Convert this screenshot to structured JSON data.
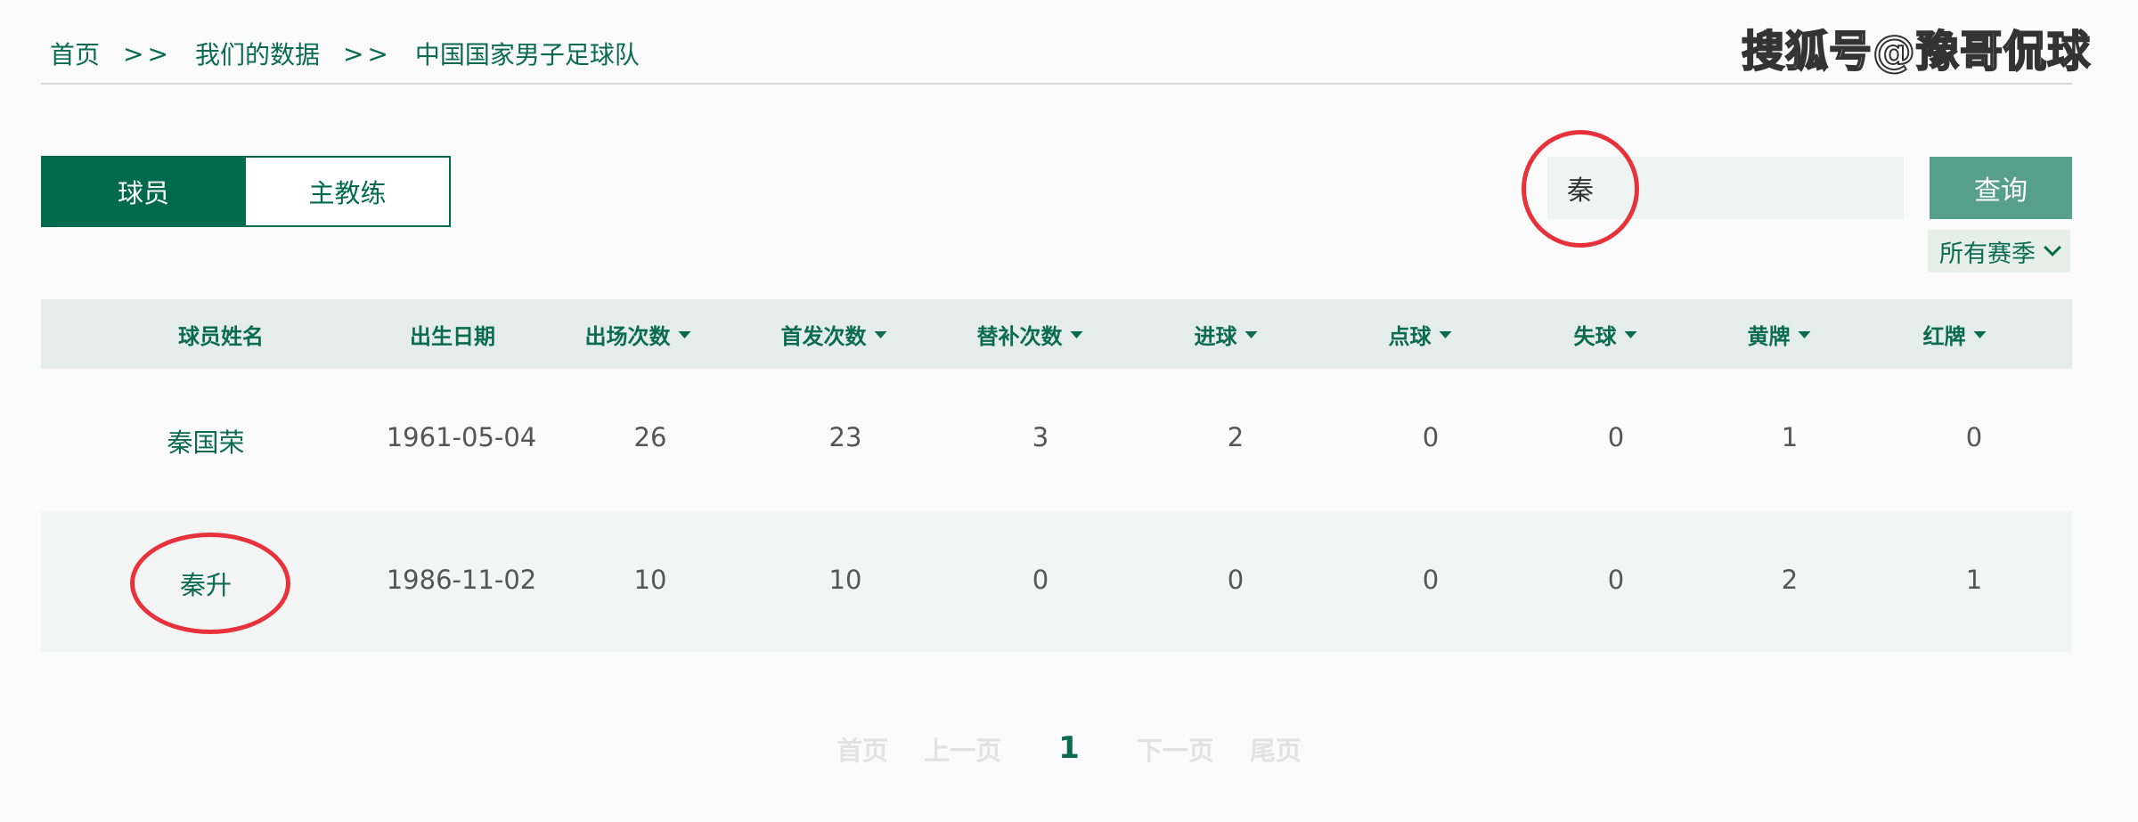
{
  "breadcrumb": {
    "home": "首页",
    "separator": ">>",
    "data": "我们的数据",
    "current": "中国国家男子足球队"
  },
  "watermark": "搜狐号@豫哥侃球",
  "tabs": [
    {
      "label": "球员",
      "active": true
    },
    {
      "label": "主教练",
      "active": false
    }
  ],
  "search": {
    "value": "秦",
    "button": "查询"
  },
  "season_filter": {
    "selected": "所有赛季"
  },
  "table": {
    "headers": [
      "球员姓名",
      "出生日期",
      "出场次数",
      "首发次数",
      "替补次数",
      "进球",
      "点球",
      "失球",
      "黄牌",
      "红牌"
    ],
    "sortable": [
      false,
      false,
      true,
      true,
      true,
      true,
      true,
      true,
      true,
      true
    ],
    "rows": [
      [
        "秦国荣",
        "1961-05-04",
        "26",
        "23",
        "3",
        "2",
        "0",
        "0",
        "1",
        "0"
      ],
      [
        "秦升",
        "1986-11-02",
        "10",
        "10",
        "0",
        "0",
        "0",
        "0",
        "2",
        "1"
      ]
    ]
  },
  "pagination": {
    "first": "首页",
    "prev": "上一页",
    "current": "1",
    "next": "下一页",
    "last": "尾页"
  },
  "colors": {
    "primary": "#006a4e",
    "button": "#56a08b",
    "annotation": "#e8323b"
  }
}
